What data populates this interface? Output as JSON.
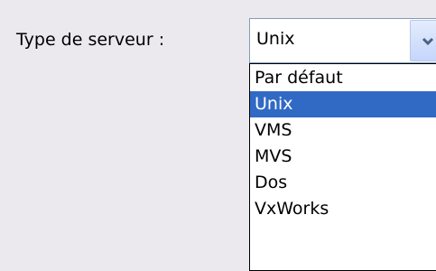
{
  "field": {
    "label": "Type de serveur :"
  },
  "combo": {
    "selected_value": "Unix",
    "button_icon": "chevron-down-icon"
  },
  "dropdown": {
    "options": [
      {
        "label": "Par défaut",
        "selected": false
      },
      {
        "label": "Unix",
        "selected": true
      },
      {
        "label": "VMS",
        "selected": false
      },
      {
        "label": "MVS",
        "selected": false
      },
      {
        "label": "Dos",
        "selected": false
      },
      {
        "label": "VxWorks",
        "selected": false
      }
    ]
  },
  "colors": {
    "selection_bg": "#316ac5",
    "selection_text": "#ffffff",
    "window_bg": "#ebe9ed"
  }
}
